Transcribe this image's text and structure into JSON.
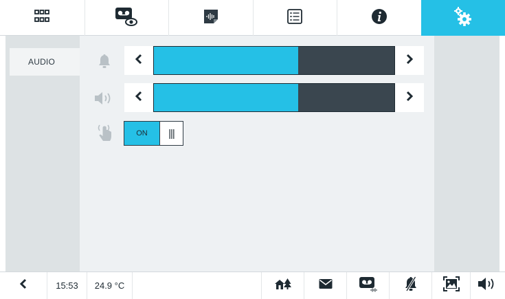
{
  "top_tabs": [
    {
      "id": "home",
      "icon": "grid-icon"
    },
    {
      "id": "video",
      "icon": "videomessage-view-icon"
    },
    {
      "id": "recordings",
      "icon": "audio-note-icon"
    },
    {
      "id": "list",
      "icon": "list-icon"
    },
    {
      "id": "info",
      "icon": "info-icon"
    },
    {
      "id": "settings",
      "icon": "settings-gears-icon",
      "active": true
    }
  ],
  "sidebar": {
    "items": [
      {
        "label": "AUDIO",
        "selected": true
      }
    ]
  },
  "audio": {
    "ringtone_volume": {
      "icon": "bell-icon",
      "level": 0.6
    },
    "speaker_volume": {
      "icon": "speaker-icon",
      "level": 0.6
    },
    "touch_sound": {
      "icon": "touch-sound-icon",
      "on_label": "ON",
      "off_label": "|||",
      "state": "on"
    }
  },
  "bottombar": {
    "time": "15:53",
    "temperature": "24.9 °C",
    "icons": [
      "home-trees-icon",
      "envelope-icon",
      "videomessage-audio-icon",
      "bell-muted-icon",
      "picture-frame-icon",
      "speaker-icon"
    ]
  },
  "colors": {
    "accent": "#25c0e6",
    "track": "#3a464f",
    "text": "#1e2a32",
    "panel": "#dde2e4",
    "content": "#eef1f3"
  }
}
